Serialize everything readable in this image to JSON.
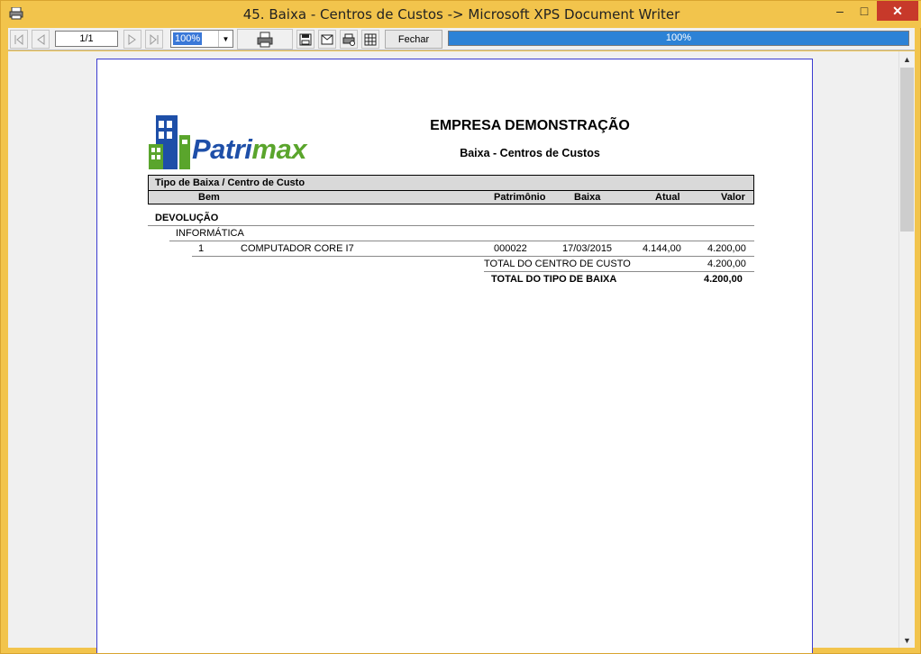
{
  "window": {
    "title": "45. Baixa - Centros de Custos -> Microsoft XPS Document Writer",
    "minimize": "–",
    "maximize": "□",
    "close": "✕"
  },
  "toolbar": {
    "page": "1/1",
    "zoom": "100%",
    "close_label": "Fechar",
    "progress_text": "100%",
    "progress_value": 1.0
  },
  "report": {
    "logo_part1": "Patri",
    "logo_part2": "max",
    "company": "EMPRESA DEMONSTRAÇÃO",
    "title": "Baixa - Centros de Custos",
    "header_group": "Tipo de Baixa / Centro de Custo",
    "columns": {
      "bem": "Bem",
      "patrimonio": "Patrimônio",
      "baixa": "Baixa",
      "atual": "Atual",
      "valor": "Valor"
    },
    "group_type": "DEVOLUÇÃO",
    "cost_center": "INFORMÁTICA",
    "rows": [
      {
        "num": "1",
        "bem": "COMPUTADOR CORE I7",
        "patrimonio": "000022",
        "baixa": "17/03/2015",
        "atual": "4.144,00",
        "valor": "4.200,00"
      }
    ],
    "total_center_label": "TOTAL DO CENTRO DE CUSTO",
    "total_center_value": "4.200,00",
    "total_type_label": "TOTAL DO TIPO DE BAIXA",
    "total_type_value": "4.200,00"
  },
  "colors": {
    "window_frame": "#f2c44c",
    "progress": "#2c82d6",
    "page_border": "#3b3bd0",
    "logo_blue": "#1e4fa8",
    "logo_green": "#5aa52c"
  }
}
